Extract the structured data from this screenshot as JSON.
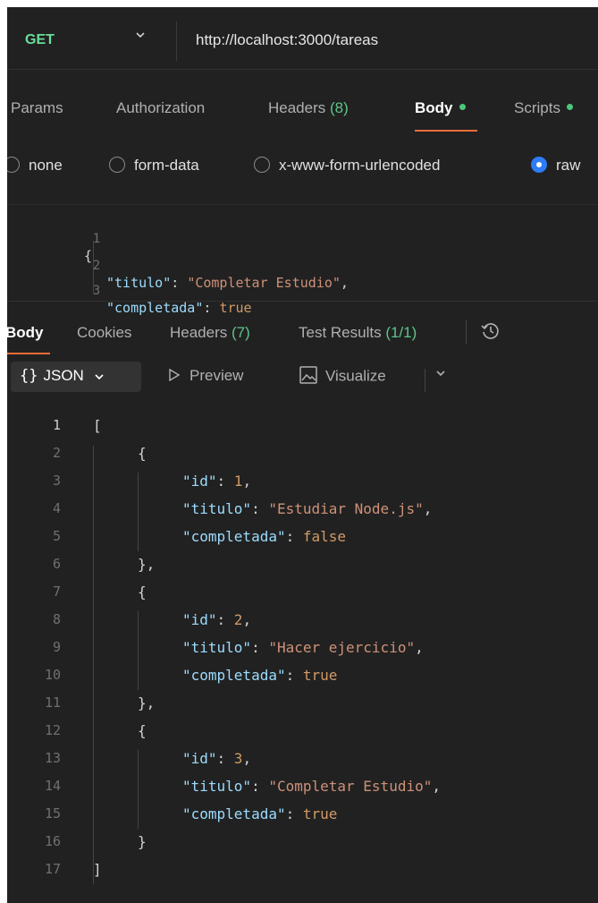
{
  "request": {
    "method": "GET",
    "url": "http://localhost:3000/tareas"
  },
  "request_tabs": [
    {
      "label": "Params",
      "count": "",
      "dot": false,
      "active": false
    },
    {
      "label": "Authorization",
      "count": "",
      "dot": false,
      "active": false
    },
    {
      "label": "Headers ",
      "count": "(8)",
      "dot": false,
      "active": false
    },
    {
      "label": "Body",
      "count": "",
      "dot": true,
      "active": true
    },
    {
      "label": "Scripts",
      "count": "",
      "dot": true,
      "active": false
    }
  ],
  "body_types": [
    {
      "label": "none",
      "selected": false
    },
    {
      "label": "form-data",
      "selected": false
    },
    {
      "label": "x-www-form-urlencoded",
      "selected": false
    },
    {
      "label": "raw",
      "selected": true
    }
  ],
  "request_body": [
    {
      "n": "1",
      "text": "{"
    },
    {
      "n": "2",
      "key": "\"titulo\"",
      "value": "\"Completar Estudio\"",
      "vtype": "str",
      "tail": ","
    },
    {
      "n": "3",
      "key": "\"completada\"",
      "value": "true",
      "vtype": "bool",
      "tail": ""
    }
  ],
  "response_tabs": [
    {
      "label": "Body",
      "count": "",
      "active": true
    },
    {
      "label": "Cookies",
      "count": "",
      "active": false
    },
    {
      "label": "Headers ",
      "count": "(7)",
      "active": false
    },
    {
      "label": "Test Results ",
      "count": "(1/1)",
      "active": false
    }
  ],
  "response_toolbar": {
    "format_icon": "{}",
    "format_label": "JSON",
    "preview_label": "Preview",
    "visualize_label": "Visualize"
  },
  "response_body": [
    {
      "n": "1",
      "text": "["
    },
    {
      "n": "2",
      "text": "{"
    },
    {
      "n": "3",
      "key": "\"id\"",
      "value": "1",
      "vtype": "num",
      "tail": ","
    },
    {
      "n": "4",
      "key": "\"titulo\"",
      "value": "\"Estudiar Node.js\"",
      "vtype": "str",
      "tail": ","
    },
    {
      "n": "5",
      "key": "\"completada\"",
      "value": "false",
      "vtype": "bool",
      "tail": ""
    },
    {
      "n": "6",
      "text": "},"
    },
    {
      "n": "7",
      "text": "{"
    },
    {
      "n": "8",
      "key": "\"id\"",
      "value": "2",
      "vtype": "num",
      "tail": ","
    },
    {
      "n": "9",
      "key": "\"titulo\"",
      "value": "\"Hacer ejercicio\"",
      "vtype": "str",
      "tail": ","
    },
    {
      "n": "10",
      "key": "\"completada\"",
      "value": "true",
      "vtype": "bool",
      "tail": ""
    },
    {
      "n": "11",
      "text": "},"
    },
    {
      "n": "12",
      "text": "{"
    },
    {
      "n": "13",
      "key": "\"id\"",
      "value": "3",
      "vtype": "num",
      "tail": ","
    },
    {
      "n": "14",
      "key": "\"titulo\"",
      "value": "\"Completar Estudio\"",
      "vtype": "str",
      "tail": ","
    },
    {
      "n": "15",
      "key": "\"completada\"",
      "value": "true",
      "vtype": "bool",
      "tail": ""
    },
    {
      "n": "16",
      "text": "}"
    },
    {
      "n": "17",
      "text": "]"
    }
  ],
  "colors": {
    "method": "#6bdd9a",
    "accent": "#ef6c3a",
    "count": "#5fc48a",
    "key": "#9cdcfe",
    "string": "#ce9178",
    "bool": "#d19a66",
    "radio_selected": "#2e7cf6"
  }
}
